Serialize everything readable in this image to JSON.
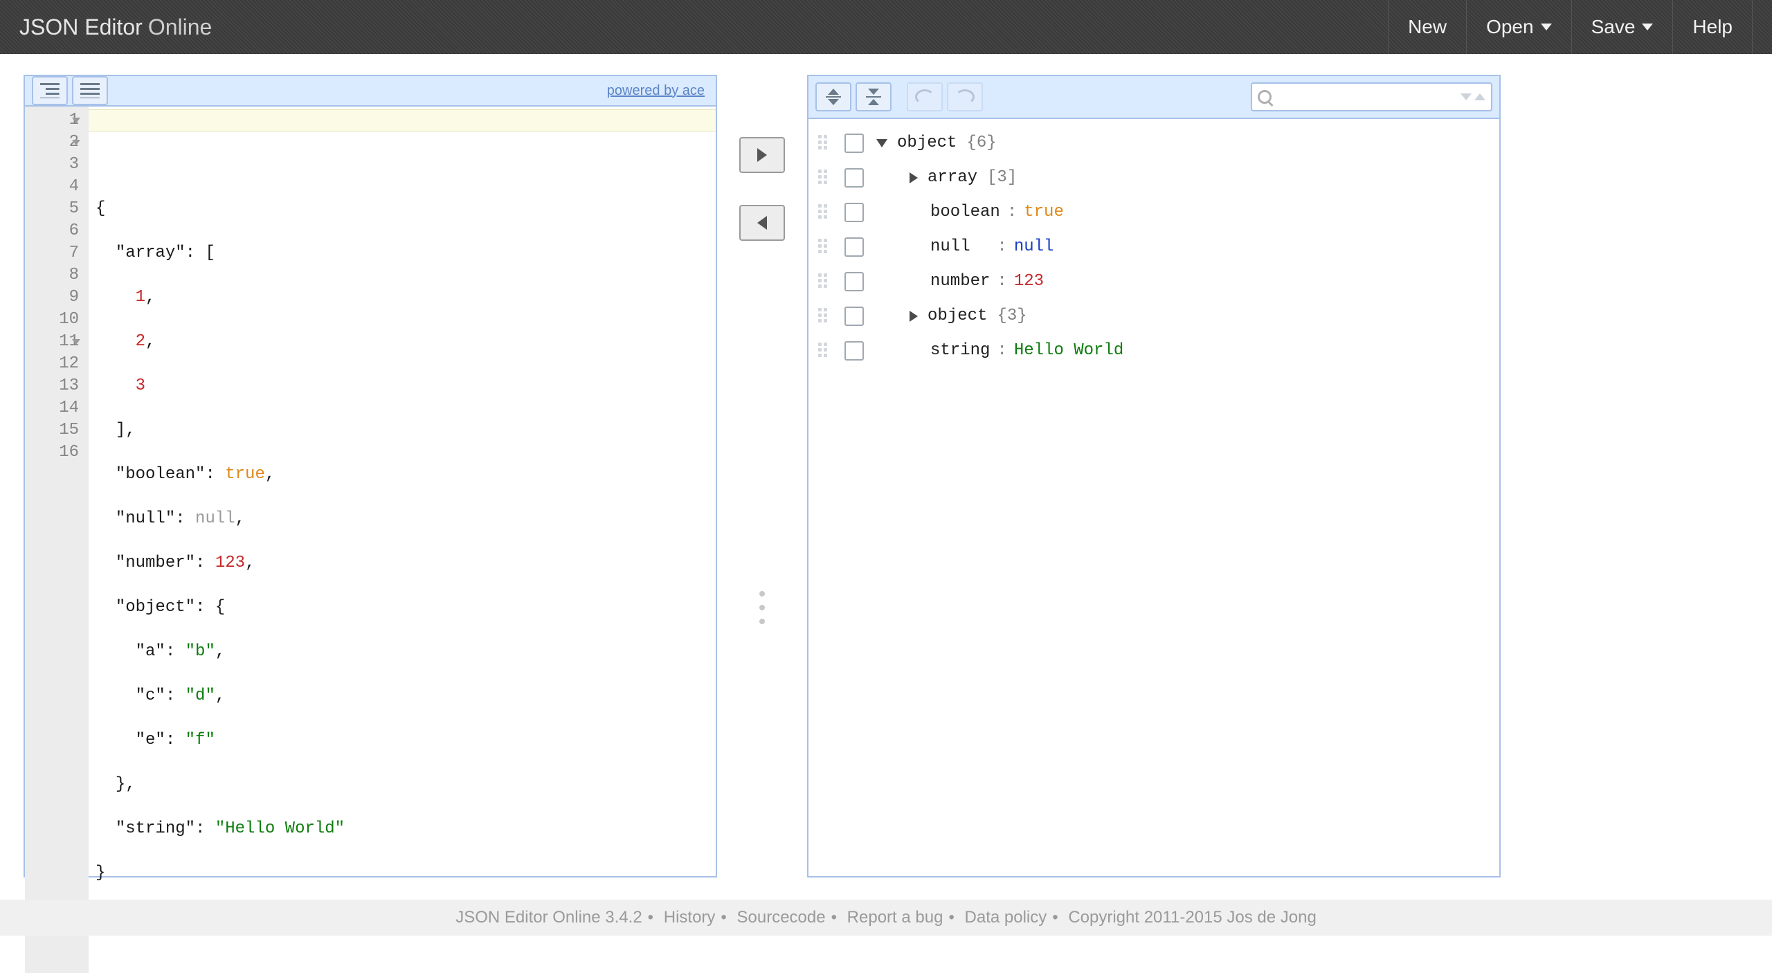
{
  "header": {
    "title_strong": "JSON Editor",
    "title_light": "Online",
    "menu": {
      "new": "New",
      "open": "Open",
      "save": "Save",
      "help": "Help"
    }
  },
  "left_panel": {
    "powered_by": "powered by ace",
    "code_lines": [
      "{",
      "  \"array\": [",
      "    1,",
      "    2,",
      "    3",
      "  ],",
      "  \"boolean\": true,",
      "  \"null\": null,",
      "  \"number\": 123,",
      "  \"object\": {",
      "    \"a\": \"b\",",
      "    \"c\": \"d\",",
      "    \"e\": \"f\"",
      "  },",
      "  \"string\": \"Hello World\"",
      "}"
    ]
  },
  "tree": {
    "root": {
      "label": "object",
      "count": "{6}"
    },
    "children": {
      "array": {
        "key": "array",
        "meta": "[3]"
      },
      "boolean": {
        "key": "boolean",
        "value": "true"
      },
      "null": {
        "key": "null",
        "value": "null"
      },
      "number": {
        "key": "number",
        "value": "123"
      },
      "object": {
        "key": "object",
        "meta": "{3}"
      },
      "string": {
        "key": "string",
        "value": "Hello World"
      }
    }
  },
  "search": {
    "placeholder": ""
  },
  "footer": {
    "app": "JSON Editor Online 3.4.2",
    "links": {
      "history": "History",
      "source": "Sourcecode",
      "bug": "Report a bug",
      "policy": "Data policy",
      "copyright": "Copyright 2011-2015 Jos de Jong"
    }
  }
}
